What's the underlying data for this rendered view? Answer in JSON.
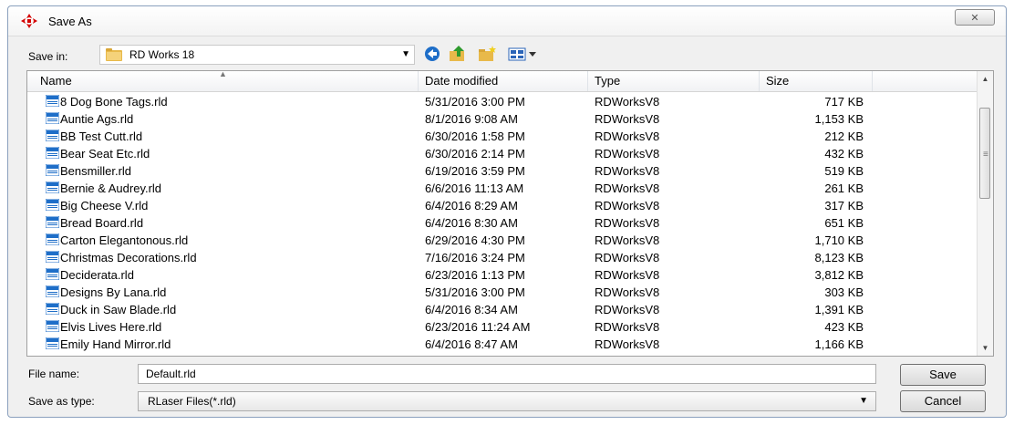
{
  "window": {
    "title": "Save As",
    "close_label": "✕"
  },
  "save_in": {
    "label": "Save in:",
    "folder": "RD Works 18"
  },
  "columns": {
    "name": "Name",
    "date": "Date modified",
    "type": "Type",
    "size": "Size"
  },
  "files": [
    {
      "name": "8 Dog Bone Tags.rld",
      "date": "5/31/2016 3:00 PM",
      "type": "RDWorksV8",
      "size": "717 KB"
    },
    {
      "name": "Auntie Ags.rld",
      "date": "8/1/2016 9:08 AM",
      "type": "RDWorksV8",
      "size": "1,153 KB"
    },
    {
      "name": "BB Test Cutt.rld",
      "date": "6/30/2016 1:58 PM",
      "type": "RDWorksV8",
      "size": "212 KB"
    },
    {
      "name": "Bear Seat Etc.rld",
      "date": "6/30/2016 2:14 PM",
      "type": "RDWorksV8",
      "size": "432 KB"
    },
    {
      "name": "Bensmiller.rld",
      "date": "6/19/2016 3:59 PM",
      "type": "RDWorksV8",
      "size": "519 KB"
    },
    {
      "name": "Bernie & Audrey.rld",
      "date": "6/6/2016 11:13 AM",
      "type": "RDWorksV8",
      "size": "261 KB"
    },
    {
      "name": "Big Cheese V.rld",
      "date": "6/4/2016 8:29 AM",
      "type": "RDWorksV8",
      "size": "317 KB"
    },
    {
      "name": "Bread Board.rld",
      "date": "6/4/2016 8:30 AM",
      "type": "RDWorksV8",
      "size": "651 KB"
    },
    {
      "name": "Carton Elegantonous.rld",
      "date": "6/29/2016 4:30 PM",
      "type": "RDWorksV8",
      "size": "1,710 KB"
    },
    {
      "name": "Christmas Decorations.rld",
      "date": "7/16/2016 3:24 PM",
      "type": "RDWorksV8",
      "size": "8,123 KB"
    },
    {
      "name": "Deciderata.rld",
      "date": "6/23/2016 1:13 PM",
      "type": "RDWorksV8",
      "size": "3,812 KB"
    },
    {
      "name": "Designs By Lana.rld",
      "date": "5/31/2016 3:00 PM",
      "type": "RDWorksV8",
      "size": "303 KB"
    },
    {
      "name": "Duck in Saw Blade.rld",
      "date": "6/4/2016 8:34 AM",
      "type": "RDWorksV8",
      "size": "1,391 KB"
    },
    {
      "name": "Elvis Lives Here.rld",
      "date": "6/23/2016 11:24 AM",
      "type": "RDWorksV8",
      "size": "423 KB"
    },
    {
      "name": "Emily Hand Mirror.rld",
      "date": "6/4/2016 8:47 AM",
      "type": "RDWorksV8",
      "size": "1,166 KB"
    }
  ],
  "file_name": {
    "label": "File name:",
    "value": "Default.rld"
  },
  "save_as_type": {
    "label": "Save as type:",
    "value": "RLaser Files(*.rld)"
  },
  "buttons": {
    "save": "Save",
    "cancel": "Cancel"
  },
  "icons": {
    "app": "red-arrows-icon",
    "folder": "folder-icon",
    "back": "back-icon",
    "up": "up-folder-icon",
    "new_folder": "new-folder-icon",
    "views": "views-menu-icon",
    "file": "rld-file-icon"
  },
  "colors": {
    "accent": "#1e6ec8",
    "app_icon": "#d40000",
    "folder": "#e8b94a"
  }
}
